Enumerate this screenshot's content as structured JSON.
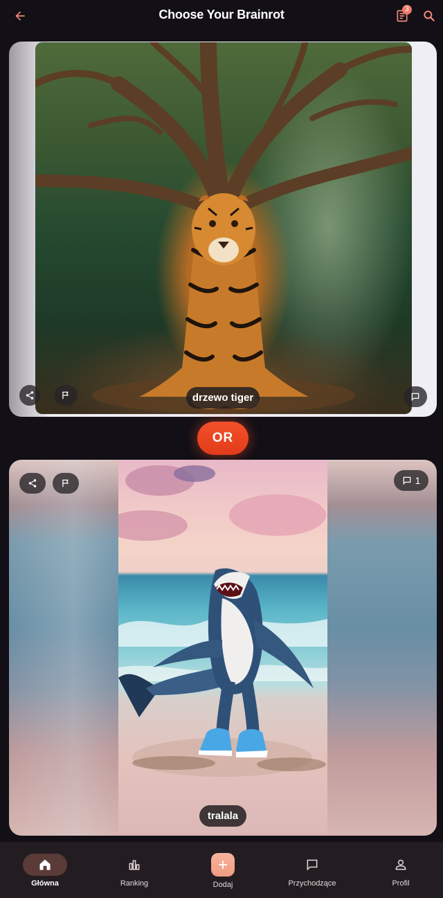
{
  "header": {
    "title": "Choose Your Brainrot",
    "notifications_count": "3"
  },
  "card_top": {
    "name": "drzewo tiger",
    "comment_count": ""
  },
  "or_label": "OR",
  "card_bottom": {
    "name": "tralala",
    "comment_count": "1"
  },
  "nav": {
    "items": [
      {
        "label": "Główna",
        "icon": "home-icon",
        "active": true
      },
      {
        "label": "Ranking",
        "icon": "bar-chart-icon",
        "active": false
      },
      {
        "label": "Dodaj",
        "icon": "plus-icon",
        "active": false
      },
      {
        "label": "Przychodzące",
        "icon": "chat-icon",
        "active": false
      },
      {
        "label": "Profil",
        "icon": "person-icon",
        "active": false
      }
    ]
  },
  "colors": {
    "background": "#120f16",
    "accent": "#e23c1a",
    "nav_background": "#231d22",
    "active_pill": "#5a3b37",
    "badge": "#f07a68",
    "add_button": "#ef9c82"
  }
}
